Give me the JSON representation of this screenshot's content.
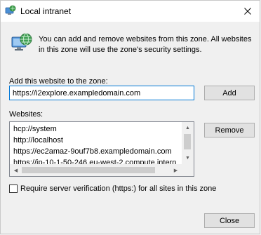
{
  "window": {
    "title": "Local intranet",
    "title_icon": "intranet-icon",
    "close_glyph": "✕"
  },
  "intro": {
    "icon": "globe-computer-icon",
    "text": "You can add and remove websites from this zone. All websites in this zone will use the zone's security settings."
  },
  "add_section": {
    "label": "Add this website to the zone:",
    "input_value": "https://i2explore.exampledomain.com",
    "add_button": "Add"
  },
  "websites": {
    "label": "Websites:",
    "items": [
      "hcp://system",
      "http://localhost",
      "https://ec2amaz-9ouf7b8.exampledomain.com",
      "https://ip-10-1-50-246.eu-west-2.compute.intern"
    ],
    "remove_button": "Remove"
  },
  "verification": {
    "label": "Require server verification (https:) for all sites in this zone",
    "checked": false
  },
  "footer": {
    "close_button": "Close"
  },
  "colors": {
    "focus_border": "#0078d7",
    "dialog_bg": "#f0f0f0",
    "button_bg": "#e1e1e1"
  }
}
